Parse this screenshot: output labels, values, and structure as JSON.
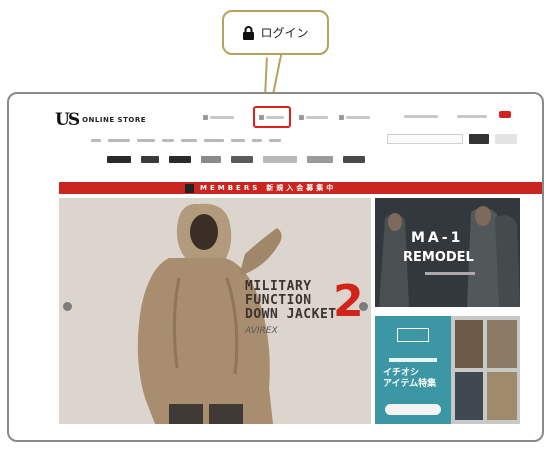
{
  "callout": {
    "label": "ログイン",
    "icon": "lock-icon",
    "border_color": "#b8a15a"
  },
  "header": {
    "logo_mark": "US",
    "logo_text": "ONLINE STORE",
    "highlight_color": "#e0201a"
  },
  "banner": {
    "text": "新規入会募集中",
    "brand": "MEMBERS",
    "color": "#c8261f"
  },
  "hero": {
    "line1": "MILITARY",
    "line2": "FUNCTION",
    "line3": "DOWN JACKET",
    "number": "2",
    "sub": "AVIREX"
  },
  "side_top": {
    "title": "MA-1",
    "subtitle": "REMODEL"
  },
  "side_bottom": {
    "text_line1": "イチオシ",
    "text_line2": "アイテム特集"
  }
}
